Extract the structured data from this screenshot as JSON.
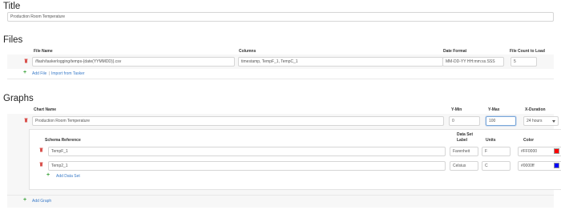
{
  "title_section": {
    "heading": "Title",
    "value": "Production Room Temperature"
  },
  "files_section": {
    "heading": "Files",
    "columns": {
      "file_name": "File Name",
      "columns": "Columns",
      "date_format": "Date Format",
      "file_count": "File Count to Load"
    },
    "row": {
      "file_name": "/flash/taskerlogging/temps-{date(YYMMDD)}.csv",
      "columns": "timestamp, TempF_1, TempC_1",
      "date_format": "MM-DD-YY HH:mm:ss.SSS",
      "file_count": "5"
    },
    "add_file": "Add File",
    "separator": "|",
    "import": "Import from Tasker"
  },
  "graphs_section": {
    "heading": "Graphs",
    "columns": {
      "chart_name": "Chart Name",
      "y_min": "Y-Min",
      "y_max": "Y-Max",
      "x_duration": "X-Duration"
    },
    "row": {
      "chart_name": "Production Room Temperature",
      "y_min": "0",
      "y_max": "100",
      "x_duration": "24 hours"
    },
    "datasets": {
      "columns": {
        "schema_reference": "Schema Reference",
        "label_line1": "Data Set",
        "label_line2": "Label",
        "units": "Units",
        "color": "Color"
      },
      "rows": [
        {
          "schema": "TempF_1",
          "label": "Farenheit",
          "units": "F",
          "color": "#FF0000"
        },
        {
          "schema": "Temp2_1",
          "label": "Celsius",
          "units": "C",
          "color": "#0000ff"
        }
      ],
      "add_data_set": "Add Data Set"
    },
    "add_graph": "Add Graph"
  },
  "colors": {
    "link": "#3a7bc8",
    "trash": "#d9534f",
    "plus": "#3ca33c"
  }
}
